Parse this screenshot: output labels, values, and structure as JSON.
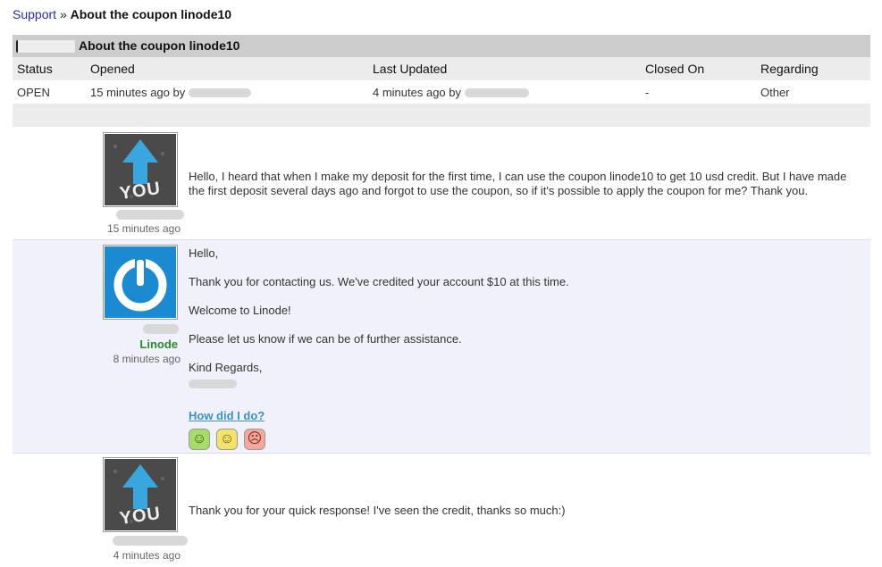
{
  "breadcrumb": {
    "link": "Support",
    "separator": "»",
    "current": "About the coupon linode10"
  },
  "ticket": {
    "header_title": "About the coupon linode10",
    "columns": [
      "Status",
      "Opened",
      "Last Updated",
      "Closed On",
      "Regarding"
    ],
    "row": {
      "status": "OPEN",
      "opened": "15 minutes ago by",
      "last_updated": "4 minutes ago by",
      "closed_on": "-",
      "regarding": "Other"
    }
  },
  "messages": [
    {
      "time": "15 minutes ago",
      "text": "Hello, I heard that when I make my deposit for the first time, I can use the coupon linode10 to get 10 usd credit. But I have made the first deposit several days ago and forgot to use the coupon, so if it's possible to apply the coupon for me? Thank you.",
      "avatar_text": "YOU"
    },
    {
      "author_org": "Linode",
      "time": "8 minutes ago",
      "lines": [
        "Hello,",
        "Thank you for contacting us. We've credited your account $10 at this time.",
        "Welcome to Linode!",
        "Please let us know if we can be of further assistance.",
        "Kind Regards,"
      ],
      "rate_label": "How did I do?",
      "ratings": [
        {
          "name": "happy",
          "glyph": "☺",
          "color": "#a6dc6a"
        },
        {
          "name": "neutral",
          "glyph": "☺",
          "color": "#f2e36a"
        },
        {
          "name": "sad",
          "glyph": "☹",
          "color": "#f5a99a"
        }
      ]
    },
    {
      "time": "4 minutes ago",
      "text": "Thank you for your quick response! I've seen the credit, thanks so much:)",
      "avatar_text": "YOU"
    }
  ],
  "colors": {
    "link": "#2a2aa8",
    "linode_green": "#2a8a2a",
    "rate_link": "#3a8fc9",
    "header_bg": "#cccccc",
    "alt_bg": "#f0f1fb",
    "linode_logo_bg": "#1b8ad0"
  }
}
